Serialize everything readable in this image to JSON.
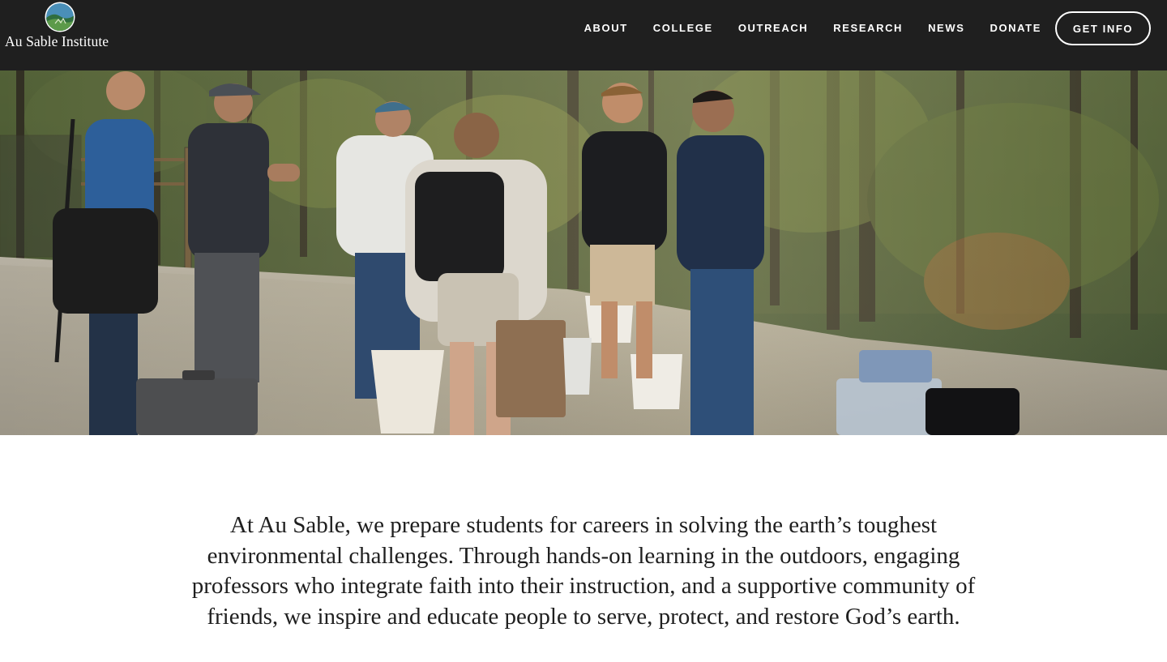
{
  "brand": {
    "name": "Au Sable Institute",
    "logo_icon": "leaf-hill-badge-icon"
  },
  "nav": {
    "items": [
      {
        "label": "ABOUT"
      },
      {
        "label": "COLLEGE"
      },
      {
        "label": "OUTREACH"
      },
      {
        "label": "RESEARCH"
      },
      {
        "label": "NEWS"
      },
      {
        "label": "DONATE"
      }
    ],
    "cta_label": "GET INFO"
  },
  "hero": {
    "image_description_icon": "students-field-photo"
  },
  "intro": {
    "text": "At Au Sable, we prepare students for careers in solving the earth’s toughest environmental challenges. Through hands-on learning in the outdoors, engaging professors who integrate faith into their instruction, and a supportive community of friends, we inspire and educate people to serve, protect, and restore God’s earth."
  },
  "colors": {
    "header_bg": "#1f1f1f",
    "text": "#1f1f1f",
    "on_dark": "#ffffff"
  }
}
